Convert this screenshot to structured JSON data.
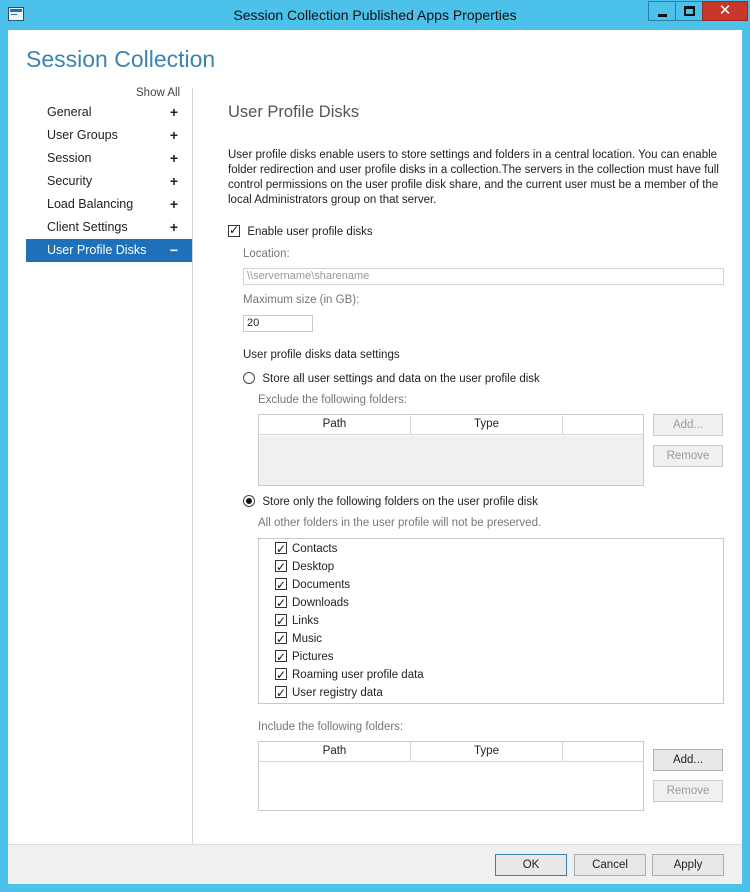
{
  "window": {
    "title": "Session Collection Published Apps Properties",
    "close_glyph": "✕"
  },
  "header": {
    "title": "Session Collection"
  },
  "nav": {
    "show_all": "Show All",
    "items": [
      {
        "label": "General",
        "toggle": "+"
      },
      {
        "label": "User Groups",
        "toggle": "+"
      },
      {
        "label": "Session",
        "toggle": "+"
      },
      {
        "label": "Security",
        "toggle": "+"
      },
      {
        "label": "Load Balancing",
        "toggle": "+"
      },
      {
        "label": "Client Settings",
        "toggle": "+"
      },
      {
        "label": "User Profile Disks",
        "toggle": "−",
        "selected": true
      }
    ]
  },
  "section": {
    "title": "User Profile Disks",
    "description": "User profile disks enable users to store settings and folders in a central location. You can enable folder redirection and user profile disks in a collection.The servers in the collection must have full control permissions on the user profile disk share, and the current user must be a member of the local Administrators group on that server.",
    "enable_label": "Enable user profile disks",
    "enable_checked": true,
    "location_label": "Location:",
    "location_placeholder": "\\\\servername\\sharename",
    "max_size_label": "Maximum size (in GB):",
    "max_size_value": "20",
    "data_settings_label": "User profile disks data settings",
    "option_all": {
      "label": "Store all user settings and data on the user profile disk",
      "selected": false,
      "exclude_label": "Exclude the following folders:",
      "columns": [
        "Path",
        "Type",
        ""
      ],
      "add_button": "Add...",
      "remove_button": "Remove"
    },
    "option_only": {
      "label": "Store only the following folders on the user profile disk",
      "selected": true,
      "note": "All other folders in the user profile will not be preserved.",
      "folders": [
        {
          "label": "Contacts",
          "checked": true
        },
        {
          "label": "Desktop",
          "checked": true
        },
        {
          "label": "Documents",
          "checked": true
        },
        {
          "label": "Downloads",
          "checked": true
        },
        {
          "label": "Links",
          "checked": true
        },
        {
          "label": "Music",
          "checked": true
        },
        {
          "label": "Pictures",
          "checked": true
        },
        {
          "label": "Roaming user profile data",
          "checked": true
        },
        {
          "label": "User registry data",
          "checked": true
        }
      ],
      "include_label": "Include the following folders:",
      "columns": [
        "Path",
        "Type",
        ""
      ],
      "add_button": "Add...",
      "remove_button": "Remove"
    }
  },
  "footer": {
    "ok": "OK",
    "cancel": "Cancel",
    "apply": "Apply"
  },
  "colors": {
    "title_bar": "#4cc1e9",
    "accent_title": "#3a84ad",
    "nav_selected": "#1e71b8",
    "close_button": "#c7382b"
  }
}
